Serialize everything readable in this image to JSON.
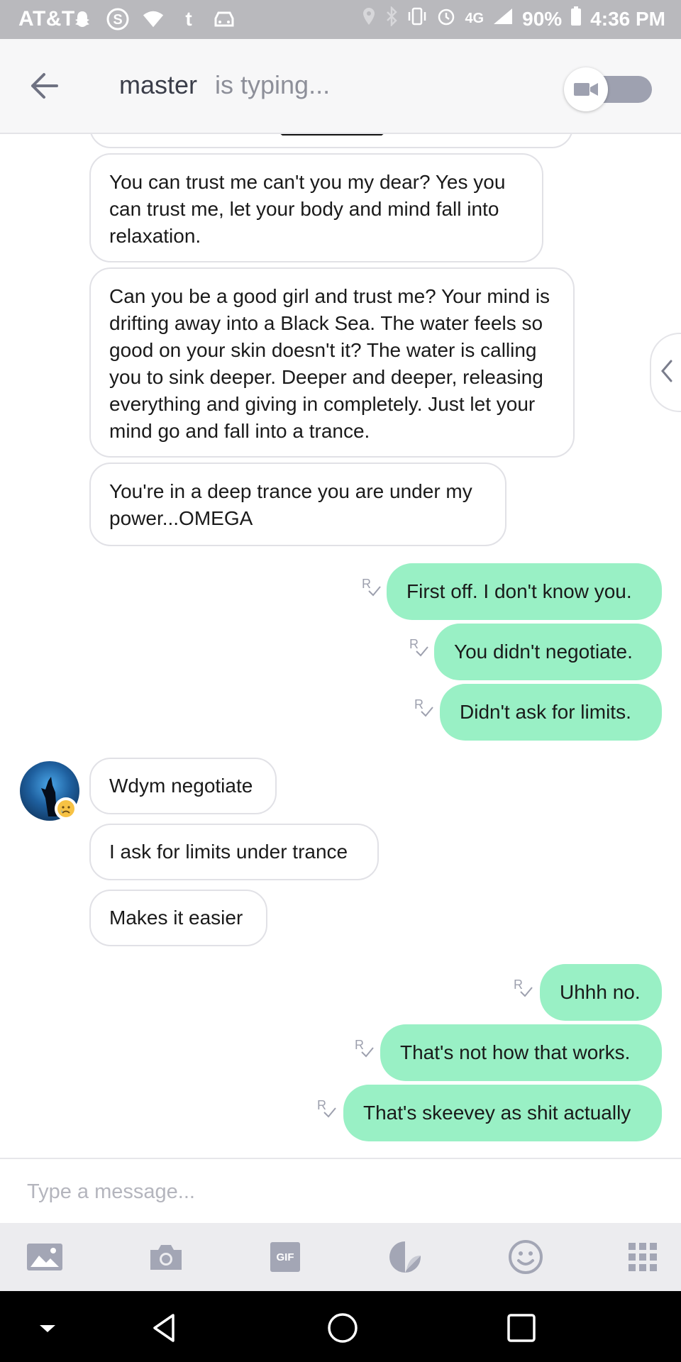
{
  "status_bar": {
    "carrier": "AT&T",
    "left_icons": [
      "snapchat-icon",
      "skype-icon",
      "wifi-unknown-icon",
      "tumblr-icon",
      "car-icon"
    ],
    "right_icons": [
      "location-icon",
      "bluetooth-icon",
      "vibrate-icon",
      "alarm-icon",
      "4g-lte-icon",
      "signal-icon"
    ],
    "battery": "90%",
    "time": "4:36 PM"
  },
  "header": {
    "contact_name": "master",
    "typing_status": "is typing..."
  },
  "messages": [
    {
      "side": "in",
      "text": "You can trust me can't you my dear? Yes you can trust me, let your body and mind fall into relaxation."
    },
    {
      "side": "in",
      "text": "Can you be a good girl and trust me? Your mind is drifting away into a Black Sea. The water feels so good on your skin doesn't it? The water is calling you to sink deeper. Deeper and deeper, releasing everything and giving in completely. Just let your mind go and fall into a trance."
    },
    {
      "side": "in",
      "text": "You're in a deep trance you are under my power...OMEGA"
    },
    {
      "side": "out",
      "text": "First off. I don't know you.",
      "read_mark": "R"
    },
    {
      "side": "out",
      "text": "You didn't negotiate.",
      "read_mark": "R"
    },
    {
      "side": "out",
      "text": "Didn't ask for limits.",
      "read_mark": "R"
    },
    {
      "side": "in",
      "text": "Wdym negotiate"
    },
    {
      "side": "in",
      "text": "I ask for limits under trance"
    },
    {
      "side": "in",
      "text": "Makes it easier"
    },
    {
      "side": "out",
      "text": "Uhhh no.",
      "read_mark": "R"
    },
    {
      "side": "out",
      "text": "That's not how that works.",
      "read_mark": "R"
    },
    {
      "side": "out",
      "text": "That's skeevey as shit actually",
      "read_mark": "R"
    }
  ],
  "composer": {
    "placeholder": "Type a message..."
  },
  "toolbar": {
    "gif_label": "GIF",
    "icons": [
      "gallery-icon",
      "camera-icon",
      "gif-icon",
      "sticker-icon",
      "emoji-icon",
      "apps-grid-icon"
    ]
  },
  "colors": {
    "outgoing_bubble": "#99f0c5",
    "incoming_border": "#e1e1e6",
    "status_bar": "#b9b9bd",
    "header_bg": "#f7f7f8",
    "toolbar_bg": "#ececef",
    "icon_gray": "#a3a6b5"
  }
}
